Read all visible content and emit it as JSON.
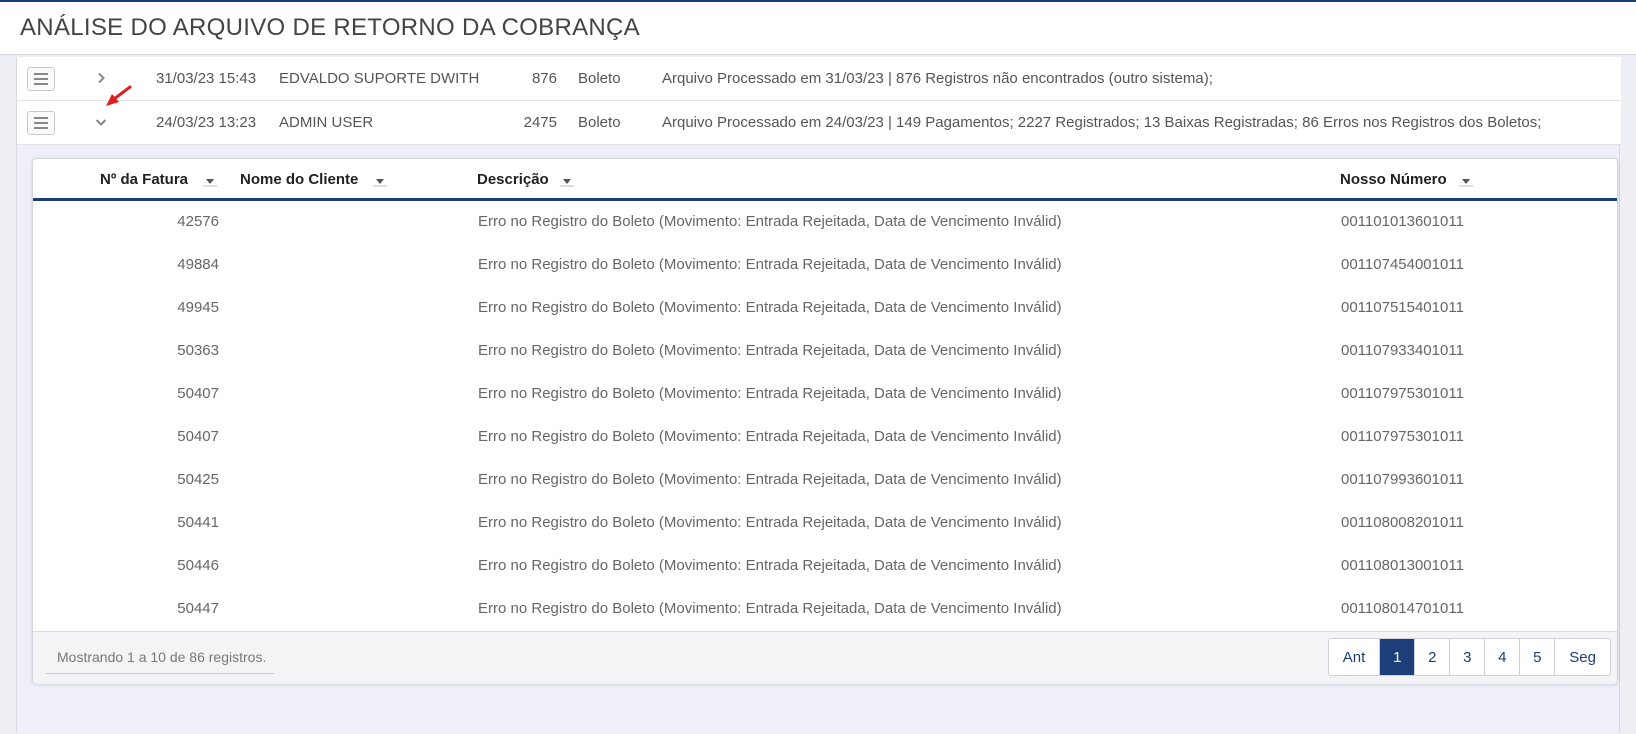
{
  "page": {
    "title": "ANÁLISE DO ARQUIVO DE RETORNO DA COBRANÇA"
  },
  "files": [
    {
      "datetime": "31/03/23 15:43",
      "user": "EDVALDO SUPORTE DWITH",
      "count": "876",
      "type": "Boleto",
      "summary": "Arquivo Processado em 31/03/23 | 876 Registros não encontrados (outro sistema);",
      "expanded": false
    },
    {
      "datetime": "24/03/23 13:23",
      "user": "ADMIN USER",
      "count": "2475",
      "type": "Boleto",
      "summary": "Arquivo Processado em 24/03/23 | 149 Pagamentos; 2227 Registrados; 13 Baixas Registradas; 86 Erros nos Registros dos Boletos;",
      "expanded": true
    }
  ],
  "grid": {
    "columns": {
      "invoice": "Nº da Fatura",
      "client": "Nome do Cliente",
      "description": "Descrição",
      "our_number": "Nosso Número"
    },
    "rows": [
      {
        "invoice": "42576",
        "client": "",
        "description": "Erro no Registro do Boleto (Movimento: Entrada Rejeitada, Data de Vencimento Inválid)",
        "our_number": "001101013601011"
      },
      {
        "invoice": "49884",
        "client": "",
        "description": "Erro no Registro do Boleto (Movimento: Entrada Rejeitada, Data de Vencimento Inválid)",
        "our_number": "001107454001011"
      },
      {
        "invoice": "49945",
        "client": "",
        "description": "Erro no Registro do Boleto (Movimento: Entrada Rejeitada, Data de Vencimento Inválid)",
        "our_number": "001107515401011"
      },
      {
        "invoice": "50363",
        "client": "",
        "description": "Erro no Registro do Boleto (Movimento: Entrada Rejeitada, Data de Vencimento Inválid)",
        "our_number": "001107933401011"
      },
      {
        "invoice": "50407",
        "client": "",
        "description": "Erro no Registro do Boleto (Movimento: Entrada Rejeitada, Data de Vencimento Inválid)",
        "our_number": "001107975301011"
      },
      {
        "invoice": "50407",
        "client": "",
        "description": "Erro no Registro do Boleto (Movimento: Entrada Rejeitada, Data de Vencimento Inválid)",
        "our_number": "001107975301011"
      },
      {
        "invoice": "50425",
        "client": "",
        "description": "Erro no Registro do Boleto (Movimento: Entrada Rejeitada, Data de Vencimento Inválid)",
        "our_number": "001107993601011"
      },
      {
        "invoice": "50441",
        "client": "",
        "description": "Erro no Registro do Boleto (Movimento: Entrada Rejeitada, Data de Vencimento Inválid)",
        "our_number": "001108008201011"
      },
      {
        "invoice": "50446",
        "client": "",
        "description": "Erro no Registro do Boleto (Movimento: Entrada Rejeitada, Data de Vencimento Inválid)",
        "our_number": "001108013001011"
      },
      {
        "invoice": "50447",
        "client": "",
        "description": "Erro no Registro do Boleto (Movimento: Entrada Rejeitada, Data de Vencimento Inválid)",
        "our_number": "001108014701011"
      }
    ],
    "footer": {
      "info": "Mostrando 1 a 10 de 86 registros.",
      "pager": {
        "prev": "Ant",
        "pages": [
          "1",
          "2",
          "3",
          "4",
          "5"
        ],
        "active": "1",
        "next": "Seg"
      }
    }
  },
  "colors": {
    "accent": "#1c3f7a",
    "annotation_arrow": "#e02020"
  },
  "icons": {
    "row_menu": "menu-lines-icon",
    "collapsed": "chevron-right-icon",
    "expanded": "chevron-down-icon",
    "sort": "caret-down-icon",
    "annotation": "red-arrow-icon"
  }
}
